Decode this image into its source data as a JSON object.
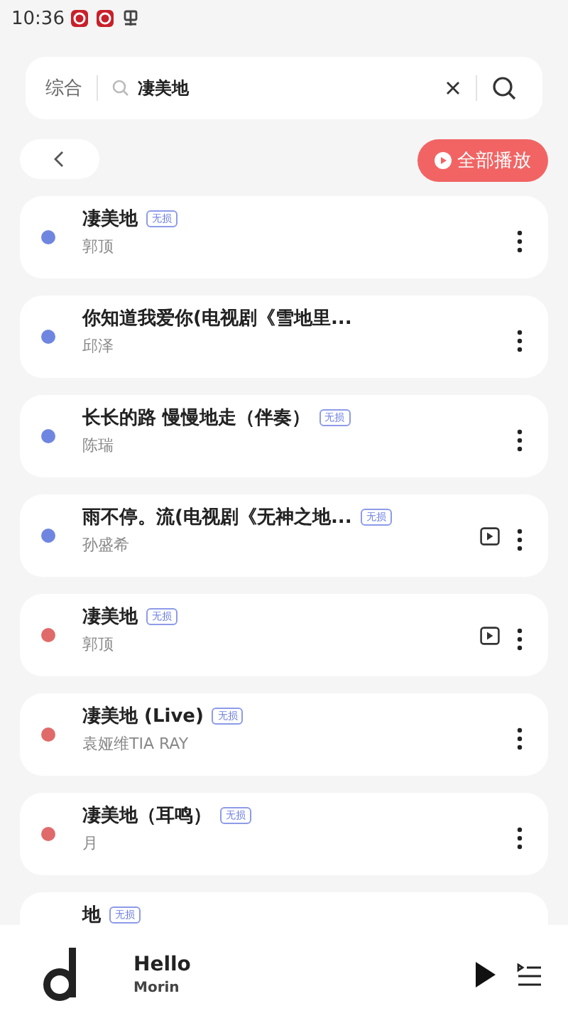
{
  "status_bar": {
    "time": "10:36"
  },
  "search": {
    "scope": "综合",
    "value": "凄美地"
  },
  "play_all": {
    "label": "全部播放"
  },
  "songs": [
    {
      "title": "凄美地",
      "badge": "无损",
      "artist": "郭顶",
      "color": "#6f86e0",
      "video": false
    },
    {
      "title": "你知道我爱你(电视剧《雪地里...",
      "artist": "邱泽",
      "color": "#6f86e0",
      "video": false
    },
    {
      "title": "长长的路 慢慢地走（伴奏）",
      "badge": "无损",
      "artist": "陈瑞",
      "color": "#6f86e0",
      "video": false
    },
    {
      "title": "雨不停。流(电视剧《无神之地...",
      "badge": "无损",
      "artist": "孙盛希",
      "color": "#6f86e0",
      "video": true
    },
    {
      "title": "凄美地",
      "badge": "无损",
      "artist": "郭顶",
      "color": "#e06a6a",
      "video": true
    },
    {
      "title": "凄美地 (Live)",
      "badge": "无损",
      "artist": "袁娅维TIA RAY",
      "color": "#e06a6a",
      "video": false
    },
    {
      "title": "凄美地（耳鸣）",
      "badge": "无损",
      "artist": "月",
      "color": "#e06a6a",
      "video": false
    },
    {
      "title": "地",
      "badge": "无损",
      "video": false
    }
  ],
  "player": {
    "title": "Hello",
    "artist": "Morin"
  }
}
